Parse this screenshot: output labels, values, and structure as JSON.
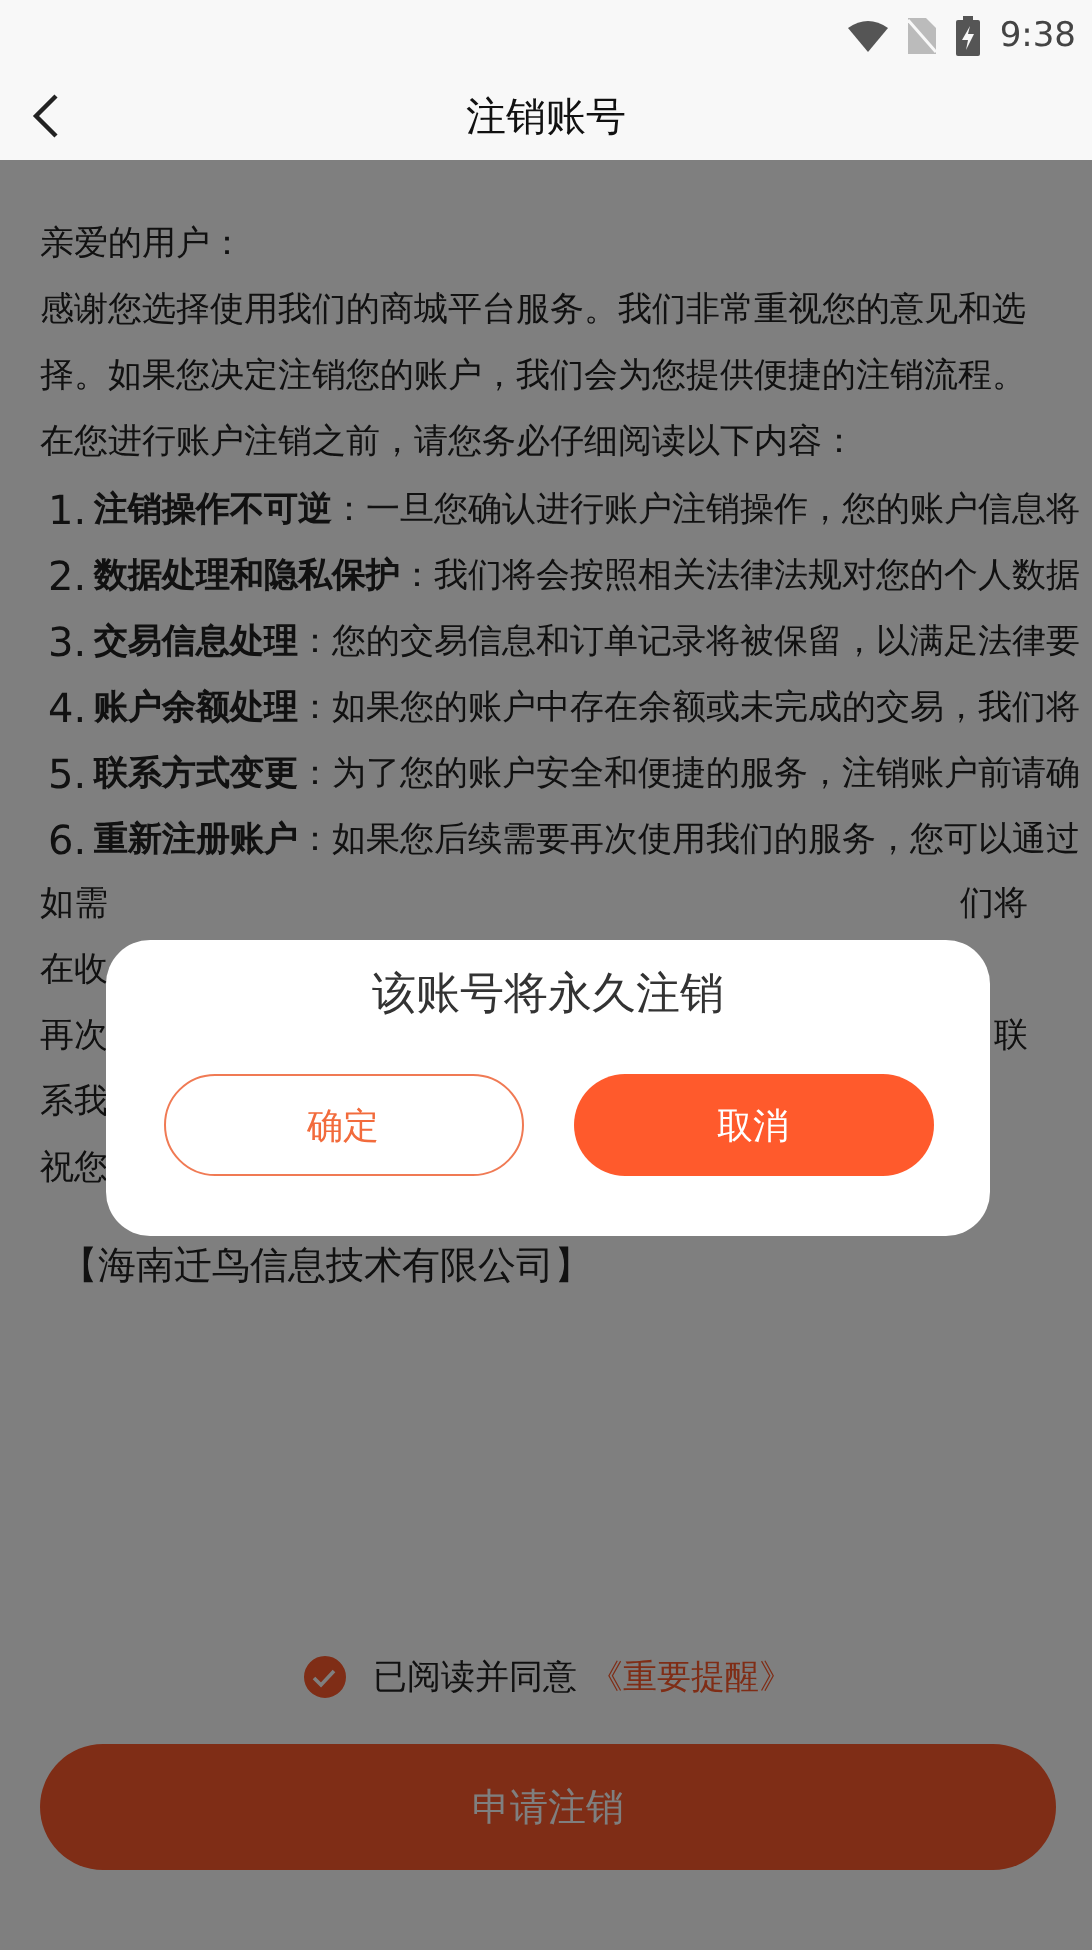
{
  "status_bar": {
    "time": "9:38"
  },
  "nav": {
    "title": "注销账号"
  },
  "content": {
    "greeting": "亲爱的用户：",
    "intro": [
      "感谢您选择使用我们的商城平台服务。我们非常重视您的意见和选",
      "择。如果您决定注销您的账户，我们会为您提供便捷的注销流程。",
      "在您进行账户注销之前，请您务必仔细阅读以下内容："
    ],
    "items": [
      {
        "number": "1.",
        "text": "**注销操作不可逆**：一旦您确认进行账户注销操作，您的账户信息将"
      },
      {
        "number": "2.",
        "text": "**数据处理和隐私保护**：我们将会按照相关法律法规对您的个人数据"
      },
      {
        "number": "3.",
        "text": "**交易信息处理**：您的交易信息和订单记录将被保留，以满足法律要"
      },
      {
        "number": "4.",
        "text": "**账户余额处理**：如果您的账户中存在余额或未完成的交易，我们将"
      },
      {
        "number": "5.",
        "text": "**联系方式变更**：为了您的账户安全和便捷的服务，注销账户前请确"
      },
      {
        "number": "6.",
        "text": "**重新注册账户**：如果您后续需要再次使用我们的服务，您可以通过"
      }
    ],
    "partial_lines": [
      {
        "left": "如需",
        "right": "们将"
      },
      {
        "left": "在收"
      },
      {
        "left": "再次",
        "right": "联"
      },
      {
        "left": "系我"
      },
      {
        "left": "祝您"
      }
    ],
    "company": "【海南迁鸟信息技术有限公司】"
  },
  "agreement": {
    "checked": true,
    "text": "已阅读并同意",
    "link": "《重要提醒》"
  },
  "submit_button": "申请注销",
  "dialog": {
    "title": "该账号将永久注销",
    "buttons": [
      {
        "label": "确定",
        "kind": "outline"
      },
      {
        "label": "取消",
        "kind": "filled"
      }
    ]
  }
}
